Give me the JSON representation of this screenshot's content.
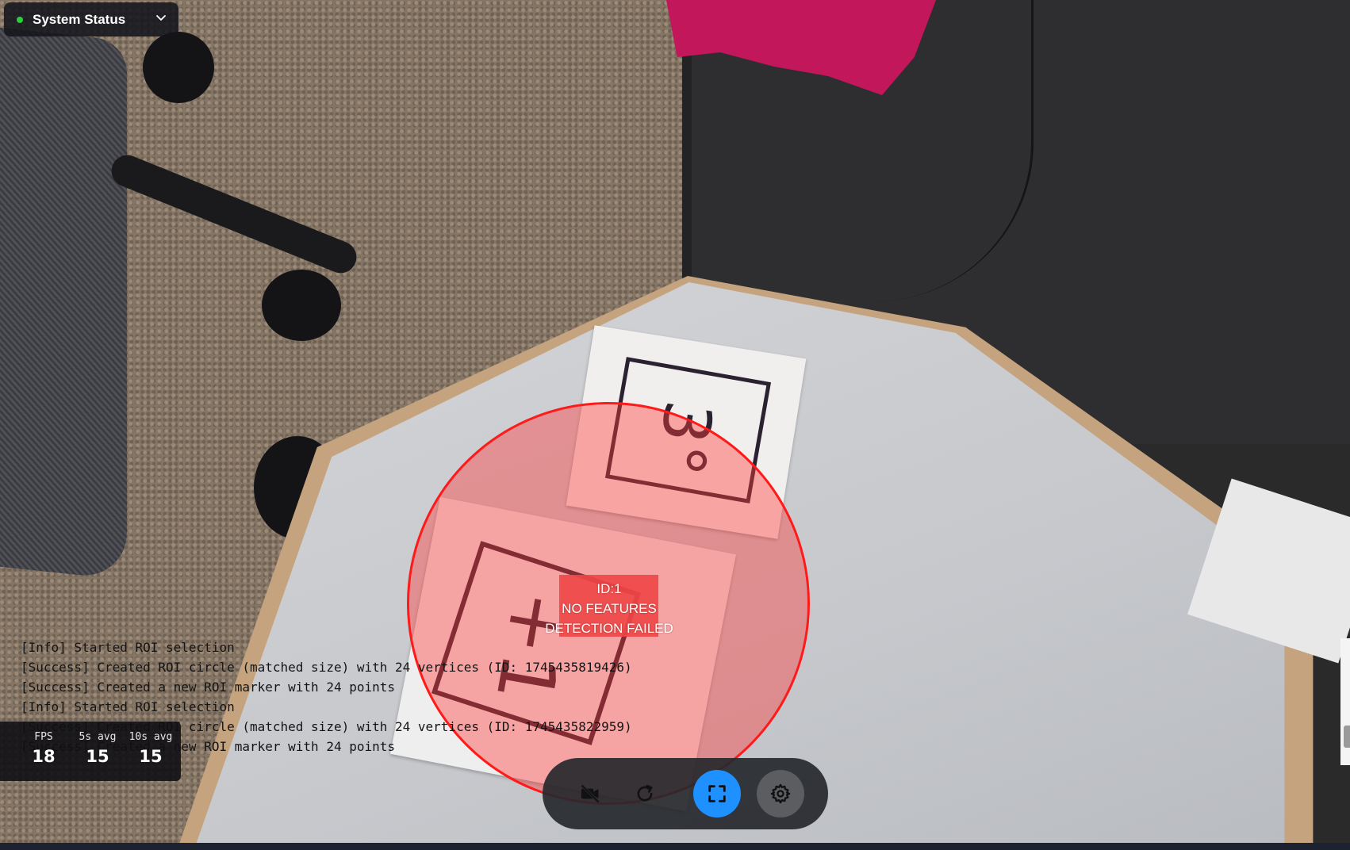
{
  "system_status": {
    "title": "System Status",
    "status_color": "#2ecc40",
    "icon": "chevron-down-icon"
  },
  "roi_overlay": {
    "id_label": "ID:1",
    "status_line_1": "NO FEATURES",
    "status_line_2": "DETECTION FAILED",
    "color": "#ff1a1a"
  },
  "log": {
    "lines": [
      "[Info] Started ROI selection",
      "[Success] Created ROI circle (matched size) with 24 vertices (ID: 1745435819426)",
      "[Success] Created a new ROI marker with 24 points",
      "[Info] Started ROI selection",
      "[Success] Created ROI circle (matched size) with 24 vertices (ID: 1745435822959)",
      "[Success] Created a new ROI marker with 24 points"
    ]
  },
  "fps": {
    "current_label": "FPS",
    "current_value": "18",
    "avg5_label": "5s avg",
    "avg5_value": "15",
    "avg10_label": "10s avg",
    "avg10_value": "15"
  },
  "controls": {
    "camera_off_icon": "camera-off-icon",
    "reload_icon": "reload-icon",
    "fullscreen_icon": "fullscreen-icon",
    "settings_icon": "gear-icon",
    "accent_color": "#1e90ff"
  }
}
